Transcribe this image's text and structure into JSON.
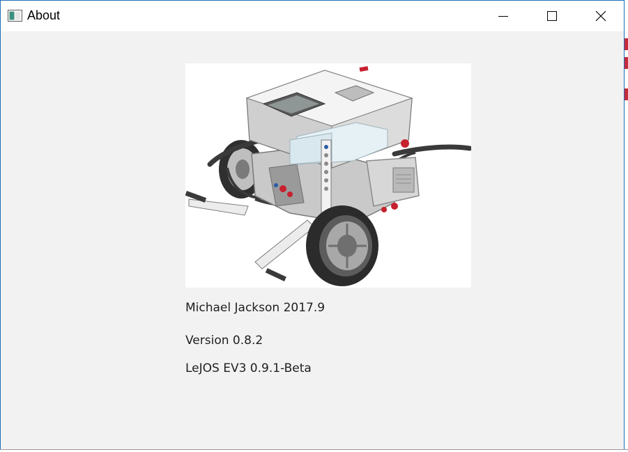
{
  "window": {
    "title": "About",
    "controls": [
      "minimize-icon",
      "maximize-icon",
      "close-icon"
    ]
  },
  "image": {
    "subject": "lego-ev3-robot"
  },
  "info": {
    "author": "Michael Jackson 2017.9",
    "version": "Version 0.8.2",
    "lejos": "LeJOS EV3 0.9.1-Beta"
  },
  "colors": {
    "title_bar": "#ffffff",
    "window_bg": "#f2f2f2",
    "accent_border": "#1f6fb8",
    "text": "#1e1e1e",
    "brick_red": "#c7202e"
  }
}
